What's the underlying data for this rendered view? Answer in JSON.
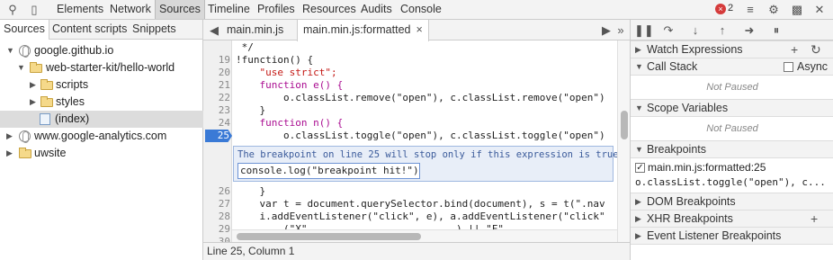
{
  "toolbar": {
    "tabs": [
      "Elements",
      "Network",
      "Sources",
      "Timeline",
      "Profiles",
      "Resources",
      "Audits",
      "Console"
    ],
    "active_tab": "Sources",
    "error_count": "2",
    "icons": [
      "search-icon",
      "device-icon",
      "console-drawer-icon",
      "settings-icon",
      "dock-icon",
      "close-icon"
    ]
  },
  "navigator": {
    "tabs": [
      "Sources",
      "Content scripts",
      "Snippets"
    ],
    "tree": [
      {
        "label": "google.github.io",
        "type": "domain"
      },
      {
        "label": "web-starter-kit/hello-world",
        "type": "folder"
      },
      {
        "label": "scripts",
        "type": "folder"
      },
      {
        "label": "styles",
        "type": "folder"
      },
      {
        "label": "(index)",
        "type": "file"
      },
      {
        "label": "www.google-analytics.com",
        "type": "domain"
      },
      {
        "label": "uwsite",
        "type": "folder"
      }
    ]
  },
  "editor": {
    "tabs": [
      {
        "label": "main.min.js"
      },
      {
        "label": "main.min.js:formatted",
        "close": "×"
      }
    ],
    "lines_before": [
      {
        "n": "",
        "text": " */"
      },
      {
        "n": "19",
        "text": "!function() {"
      },
      {
        "n": "20",
        "text": "    \"use strict\";"
      },
      {
        "n": "21",
        "text": "    function e() {"
      },
      {
        "n": "22",
        "text": "        o.classList.remove(\"open\"), c.classList.remove(\"open\"),"
      },
      {
        "n": "23",
        "text": "    }"
      },
      {
        "n": "24",
        "text": "    function n() {"
      },
      {
        "n": "25",
        "text": "        o.classList.toggle(\"open\"), c.classList.toggle(\"open\"),"
      }
    ],
    "breakpoint_hint": "The breakpoint on line 25 will stop only if this expression is true:",
    "breakpoint_condition": "console.log(\"breakpoint hit!\")",
    "lines_after": [
      {
        "n": "26",
        "text": "    }"
      },
      {
        "n": "27",
        "text": "    var t = document.querySelector.bind(document), s = t(\".navdr"
      },
      {
        "n": "28",
        "text": "    i.addEventListener(\"click\", e), a.addEventListener(\"click\","
      },
      {
        "n": "29",
        "text": "        (\"X\"             .           ) || \"F\"          ."
      },
      {
        "n": "30",
        "text": ""
      }
    ],
    "status": "Line 25, Column 1"
  },
  "sidebar": {
    "watch": "Watch Expressions",
    "call_stack": "Call Stack",
    "async": "Async",
    "not_paused": "Not Paused",
    "scope": "Scope Variables",
    "scope_not_paused": "Not Paused",
    "breakpoints": "Breakpoints",
    "bp_location": "main.min.js:formatted:25",
    "bp_code": "o.classList.toggle(\"open\"), c...",
    "dom_bp": "DOM Breakpoints",
    "xhr_bp": "XHR Breakpoints",
    "event_bp": "Event Listener Breakpoints",
    "icons": [
      "pause-icon",
      "step-over-icon",
      "step-into-icon",
      "step-out-icon",
      "deactivate-breakpoints-icon",
      "pause-on-exceptions-icon"
    ]
  },
  "colors": {
    "breakpoint": "#3a7ad6",
    "keyword": "#aa0d91",
    "string": "#c41a16"
  }
}
